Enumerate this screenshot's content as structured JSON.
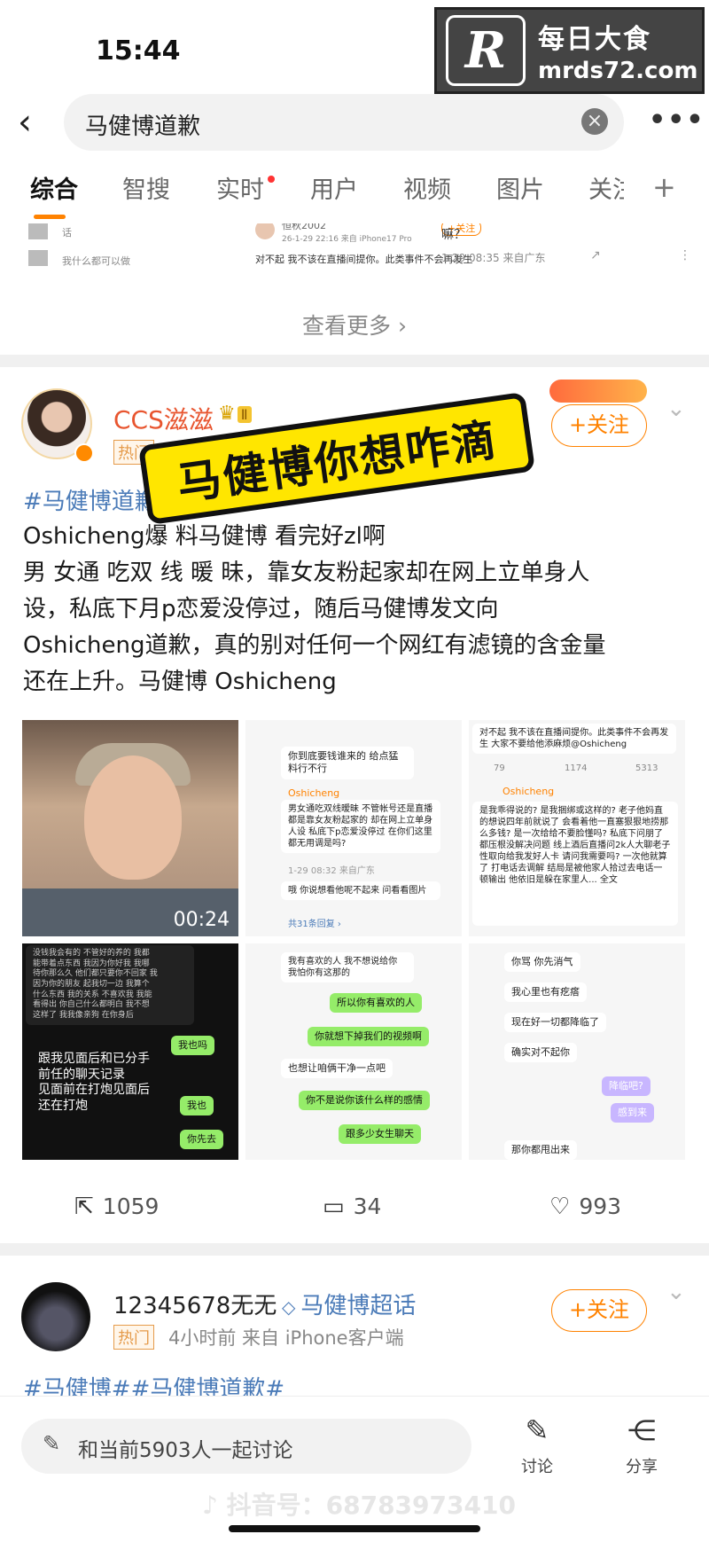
{
  "status": {
    "time": "15:44"
  },
  "watermark": {
    "logo": "R",
    "cn": "每日大食",
    "url": "mrds72.com"
  },
  "search": {
    "query": "马健博道歉",
    "back": "‹",
    "clear": "×",
    "more": "•••"
  },
  "tabs": [
    "综合",
    "智搜",
    "实时",
    "用户",
    "视频",
    "图片",
    "关注"
  ],
  "tabs_plus": "+",
  "prev_strip": {
    "c1": [
      "话",
      "我什么都可以做"
    ],
    "c2_user": "恒秋2002",
    "c2_meta": "26-1-29 22:16 来自 iPhone17 Pro",
    "c2_text": "对不起 我不该在直播间提你。此类事件不会再发生",
    "c3_text": "嘛？",
    "c3_meta": "1-29 08:35 来自广东"
  },
  "see_more": "查看更多 ›",
  "post1": {
    "username": "CCS滋滋",
    "level": "Ⅱ",
    "hot_tag": "热门",
    "follow": "+关注",
    "sticker": "马健博你想咋滴",
    "hashtag": "#马健博道歉#",
    "lines": [
      "Oshicheng爆 料马健博 看完好zl啊",
      "男 女通 吃双 线 暖 昧，靠女友粉起家却在网上立单身人",
      "设，私底下月p恋爱没停过，随后马健博发文向",
      "Oshicheng道歉，真的别对任何一个网红有滤镜的含金量",
      "还在上升。马健博 Oshicheng"
    ],
    "video_duration": "00:24",
    "img2": {
      "b1": "你到底要钱谁来的 给点猛料行不行",
      "user": "Oshicheng",
      "b2": "男女通吃双线暧昧 不管帐号还是直播都是靠女友粉起家的 却在网上立单身人设 私底下p恋爱没停过 在你们这里都无用调是吗?",
      "meta": "1-29 08:32 来自广东",
      "b3": "哦 你说想看他呢不起来 问看看图片",
      "foot": "共31条回复 ›"
    },
    "img3": {
      "b1": "对不起 我不该在直播间提你。此类事件不会再发生 大家不要给他添麻烦@Oshicheng",
      "stats": [
        "79",
        "1174",
        "5313"
      ],
      "user": "Oshicheng",
      "b2": "是我乖得说的? 是我捆绑或这样的? 老子他妈直的想说四年前就说了 会看着他一直塞狠狠地捞那么多钱? 是一次给给不要脸懂吗? 私底下问朋了都压根没解决问题 线上酒后直播问2k人大聊老子性取向给我发好人卡 请问我需要吗? 一次他就算了 打电话去调解 结局是被他家人拾过去电话一顿输出 他依旧是躲在家里人... 全文"
    },
    "img4": {
      "b1": "没钱我会有的 不管好的养的 我都\n能带着点东西 我因为你好我 我哪\n待你那么久 他们都只要你不回家 我\n因为你的朋友 起我切一边 我算个\n什么东西 我的关系 不喜欢我 我能\n看得出 你自己什么都明白 我不想\n这样了 我我像亲狗 在你身后",
      "caption": "跟我见面后和已分手\n前任的聊天记录\n见面前在打炮见面后\n还在打炮",
      "g1": "我也吗",
      "g2": "我也",
      "g3": "你先去"
    },
    "img5": {
      "w1": "我有喜欢的人 我不想说给你 我怕你有这那的",
      "g1": "所以你有喜欢的人",
      "g2": "你就想下掉我们的视频啊",
      "w2": "也想让咱俩干净一点吧",
      "g3": "你不是说你该什么样的感情",
      "g4": "跟多少女生聊天"
    },
    "img6": {
      "w1": "你骂 你先消气",
      "w2": "我心里也有疙瘩",
      "w3": "现在好一切都降临了",
      "w4": "确实对不起你",
      "p1": "降临吧?",
      "p2": "感到来",
      "w5": "那你都甩出来"
    },
    "actions": {
      "repost": "1059",
      "comment": "34",
      "like": "993"
    }
  },
  "post2": {
    "username": "12345678无无",
    "topic": "马健博超话",
    "hot_tag": "热门",
    "meta": "4小时前  来自 iPhone客户端",
    "follow": "+关注",
    "hashtag": "#马健博##马健博道歉#"
  },
  "bottom": {
    "discuss": "和当前5903人一起讨论",
    "comment_label": "讨论",
    "share_label": "分享",
    "tiktok": "♪ 抖音号：68783973410"
  }
}
